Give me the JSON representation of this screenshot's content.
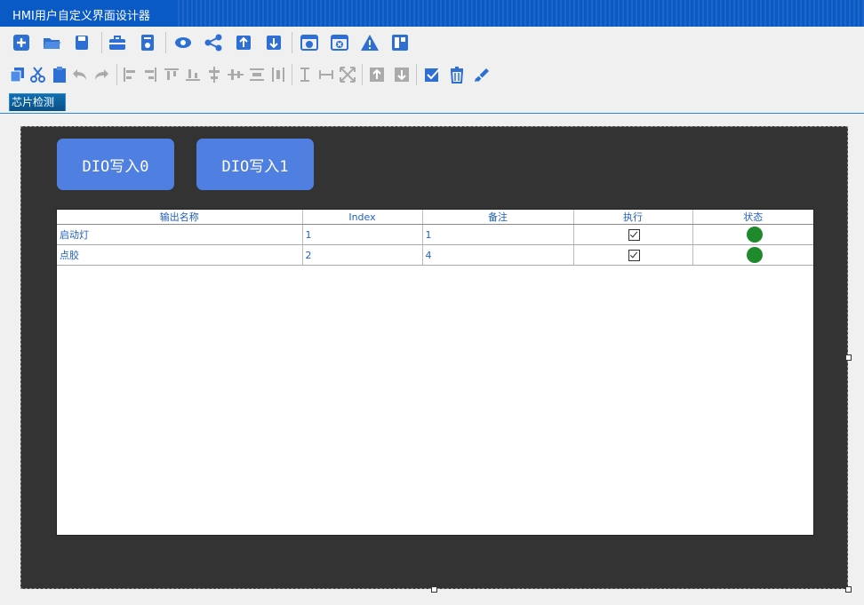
{
  "app": {
    "title": "HMI用户自定义界面设计器"
  },
  "toolbar1": [
    {
      "name": "new-page-icon"
    },
    {
      "name": "open-folder-icon"
    },
    {
      "name": "save-icon"
    },
    {
      "name": "toolbox-icon"
    },
    {
      "name": "properties-icon"
    },
    {
      "name": "preview-eye-icon"
    },
    {
      "name": "share-icon"
    },
    {
      "name": "upload-icon"
    },
    {
      "name": "download-icon"
    },
    {
      "name": "add-window-icon"
    },
    {
      "name": "close-window-icon"
    },
    {
      "name": "warning-icon"
    },
    {
      "name": "layout-icon"
    }
  ],
  "toolbar2": [
    {
      "name": "copy-icon"
    },
    {
      "name": "cut-icon"
    },
    {
      "name": "paste-icon"
    },
    {
      "name": "undo-icon"
    },
    {
      "name": "redo-icon"
    },
    {
      "name": "align-left-icon"
    },
    {
      "name": "align-right-icon"
    },
    {
      "name": "align-top-icon"
    },
    {
      "name": "align-bottom-icon"
    },
    {
      "name": "align-center-vertical-icon"
    },
    {
      "name": "align-center-horizontal-icon"
    },
    {
      "name": "distribute-vertical-icon"
    },
    {
      "name": "distribute-horizontal-icon"
    },
    {
      "name": "same-height-icon"
    },
    {
      "name": "same-width-icon"
    },
    {
      "name": "same-size-icon"
    },
    {
      "name": "bring-to-front-icon"
    },
    {
      "name": "send-to-back-icon"
    },
    {
      "name": "select-all-icon"
    },
    {
      "name": "delete-icon"
    },
    {
      "name": "clear-icon"
    }
  ],
  "tabs": [
    {
      "label": "芯片检测"
    }
  ],
  "buttons": {
    "dio0": "DIO写入0",
    "dio1": "DIO写入1"
  },
  "table": {
    "headers": [
      "输出名称",
      "Index",
      "备注",
      "执行",
      "状态"
    ],
    "rows": [
      {
        "name": "启动灯",
        "index": "1",
        "note": "1",
        "execute": true,
        "status": "on"
      },
      {
        "name": "点胶",
        "index": "2",
        "note": "4",
        "execute": true,
        "status": "on"
      }
    ],
    "status_color": "#1f8a2c"
  },
  "colors": {
    "accent": "#0a5ac6",
    "button": "#4f7fe0",
    "canvas_bg": "#333333"
  }
}
